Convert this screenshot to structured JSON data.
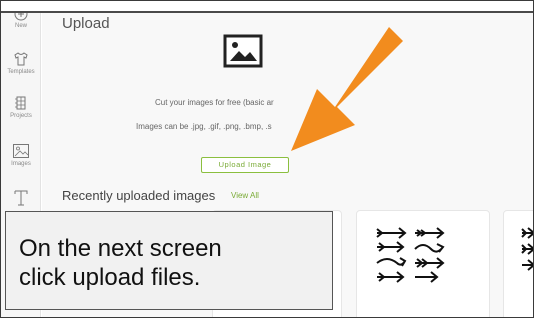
{
  "sidebar": {
    "items": [
      {
        "label": "New",
        "icon": "plus-circle-icon"
      },
      {
        "label": "Templates",
        "icon": "shirt-icon"
      },
      {
        "label": "Projects",
        "icon": "projects-icon"
      },
      {
        "label": "Images",
        "icon": "image-icon"
      },
      {
        "label": "",
        "icon": "text-icon"
      }
    ]
  },
  "main": {
    "title": "Upload",
    "description_line1": "Cut your images for free (basic ar",
    "description_line2": "Images can be .jpg, .gif, .png, .bmp, .s",
    "upload_button": "Upload Image",
    "recent_title": "Recently uploaded images",
    "view_all": "View All"
  },
  "annotation": {
    "arrow_color": "#F28C1E",
    "caption_line1": "On the next screen",
    "caption_line2": "click upload files."
  },
  "colors": {
    "accent_green": "#7AAB36",
    "arrow_orange": "#F28C1E"
  }
}
